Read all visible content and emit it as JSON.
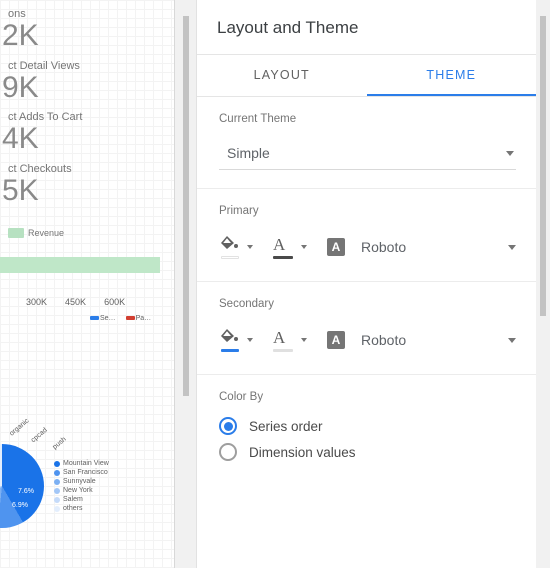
{
  "canvas": {
    "kpis": [
      {
        "label": "ons",
        "value": "2K"
      },
      {
        "label": "ct Detail Views",
        "value": "9K"
      },
      {
        "label": "ct Adds To Cart",
        "value": "4K"
      },
      {
        "label": "ct Checkouts",
        "value": "5K"
      }
    ],
    "revenue": {
      "legend": "Revenue"
    },
    "axis": [
      "300K",
      "450K",
      "600K"
    ],
    "mini_series": [
      "Se…",
      "Pa…"
    ],
    "pie": {
      "slices": [
        "7.6%",
        "6.9%"
      ],
      "terms": [
        "organic",
        "cpcad",
        "push"
      ],
      "legend": [
        "Mountain View",
        "San Francisco",
        "Sunnyvale",
        "New York",
        "Salem",
        "others"
      ]
    }
  },
  "panel": {
    "title": "Layout and Theme",
    "tabs": {
      "layout": "LAYOUT",
      "theme": "THEME"
    },
    "current_theme": {
      "label": "Current Theme",
      "value": "Simple"
    },
    "primary": {
      "label": "Primary",
      "font": "Roboto",
      "fill_underline": "#ffffff",
      "text_underline": "#4a4a4a"
    },
    "secondary": {
      "label": "Secondary",
      "font": "Roboto",
      "fill_underline": "#2b7de9",
      "text_underline": "#e0e0e0"
    },
    "color_by": {
      "label": "Color By",
      "options": {
        "series": "Series order",
        "dimension": "Dimension values"
      },
      "selected": "series"
    }
  }
}
